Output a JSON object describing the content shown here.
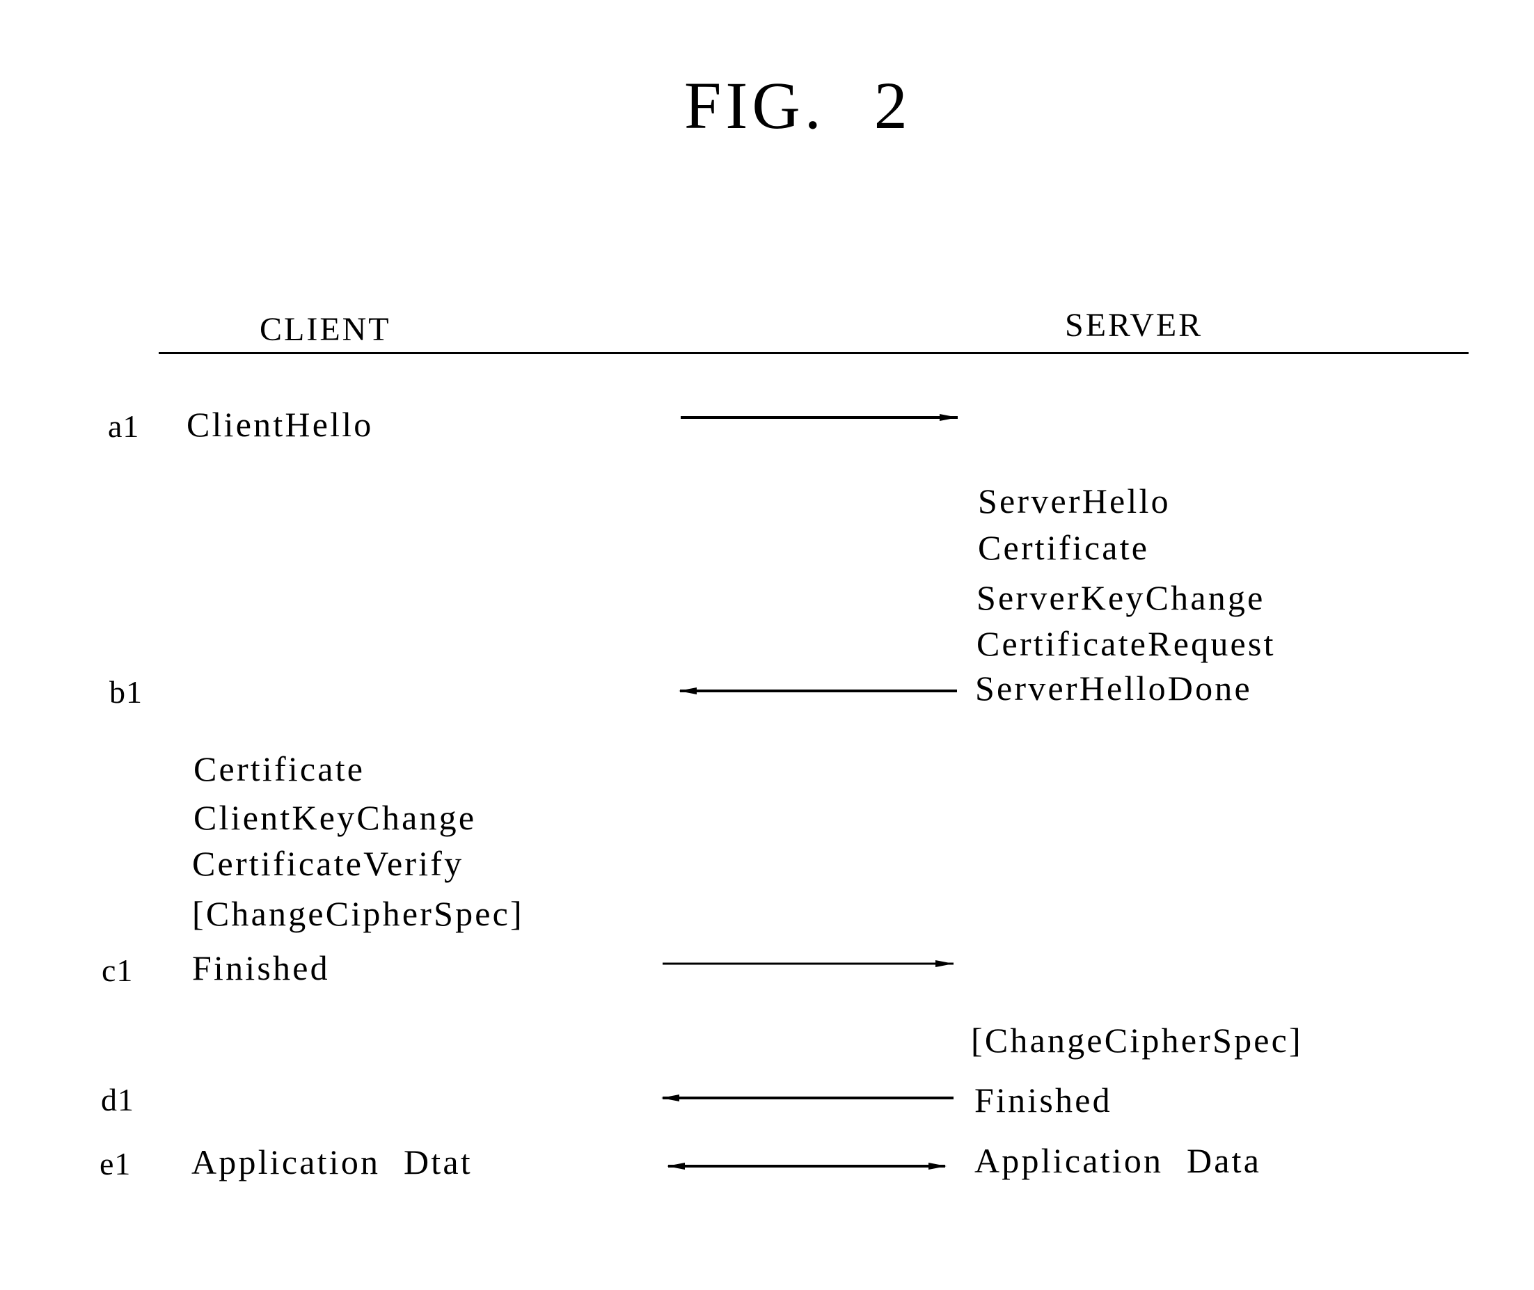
{
  "figure": {
    "title_prefix": "FIG.",
    "title_number": "2"
  },
  "columns": {
    "client": "CLIENT",
    "server": "SERVER"
  },
  "steps": [
    {
      "id": "a1",
      "label": "a1",
      "direction": "client-to-server",
      "client_messages": [
        "ClientHello"
      ],
      "server_messages": []
    },
    {
      "id": "b1",
      "label": "b1",
      "direction": "server-to-client",
      "client_messages": [],
      "server_messages": [
        "ServerHello",
        "Certificate",
        "ServerKeyChange",
        "CertificateRequest",
        "ServerHelloDone"
      ]
    },
    {
      "id": "c1",
      "label": "c1",
      "direction": "client-to-server",
      "client_messages": [
        "Certificate",
        "ClientKeyChange",
        "CertificateVerify",
        "[ChangeCipherSpec]",
        "Finished"
      ],
      "server_messages": []
    },
    {
      "id": "d1",
      "label": "d1",
      "direction": "server-to-client",
      "client_messages": [],
      "server_messages": [
        "[ChangeCipherSpec]",
        "Finished"
      ]
    },
    {
      "id": "e1",
      "label": "e1",
      "direction": "bidirectional",
      "client_messages": [
        "Application Dtat"
      ],
      "server_messages": [
        "Application Data"
      ]
    }
  ]
}
